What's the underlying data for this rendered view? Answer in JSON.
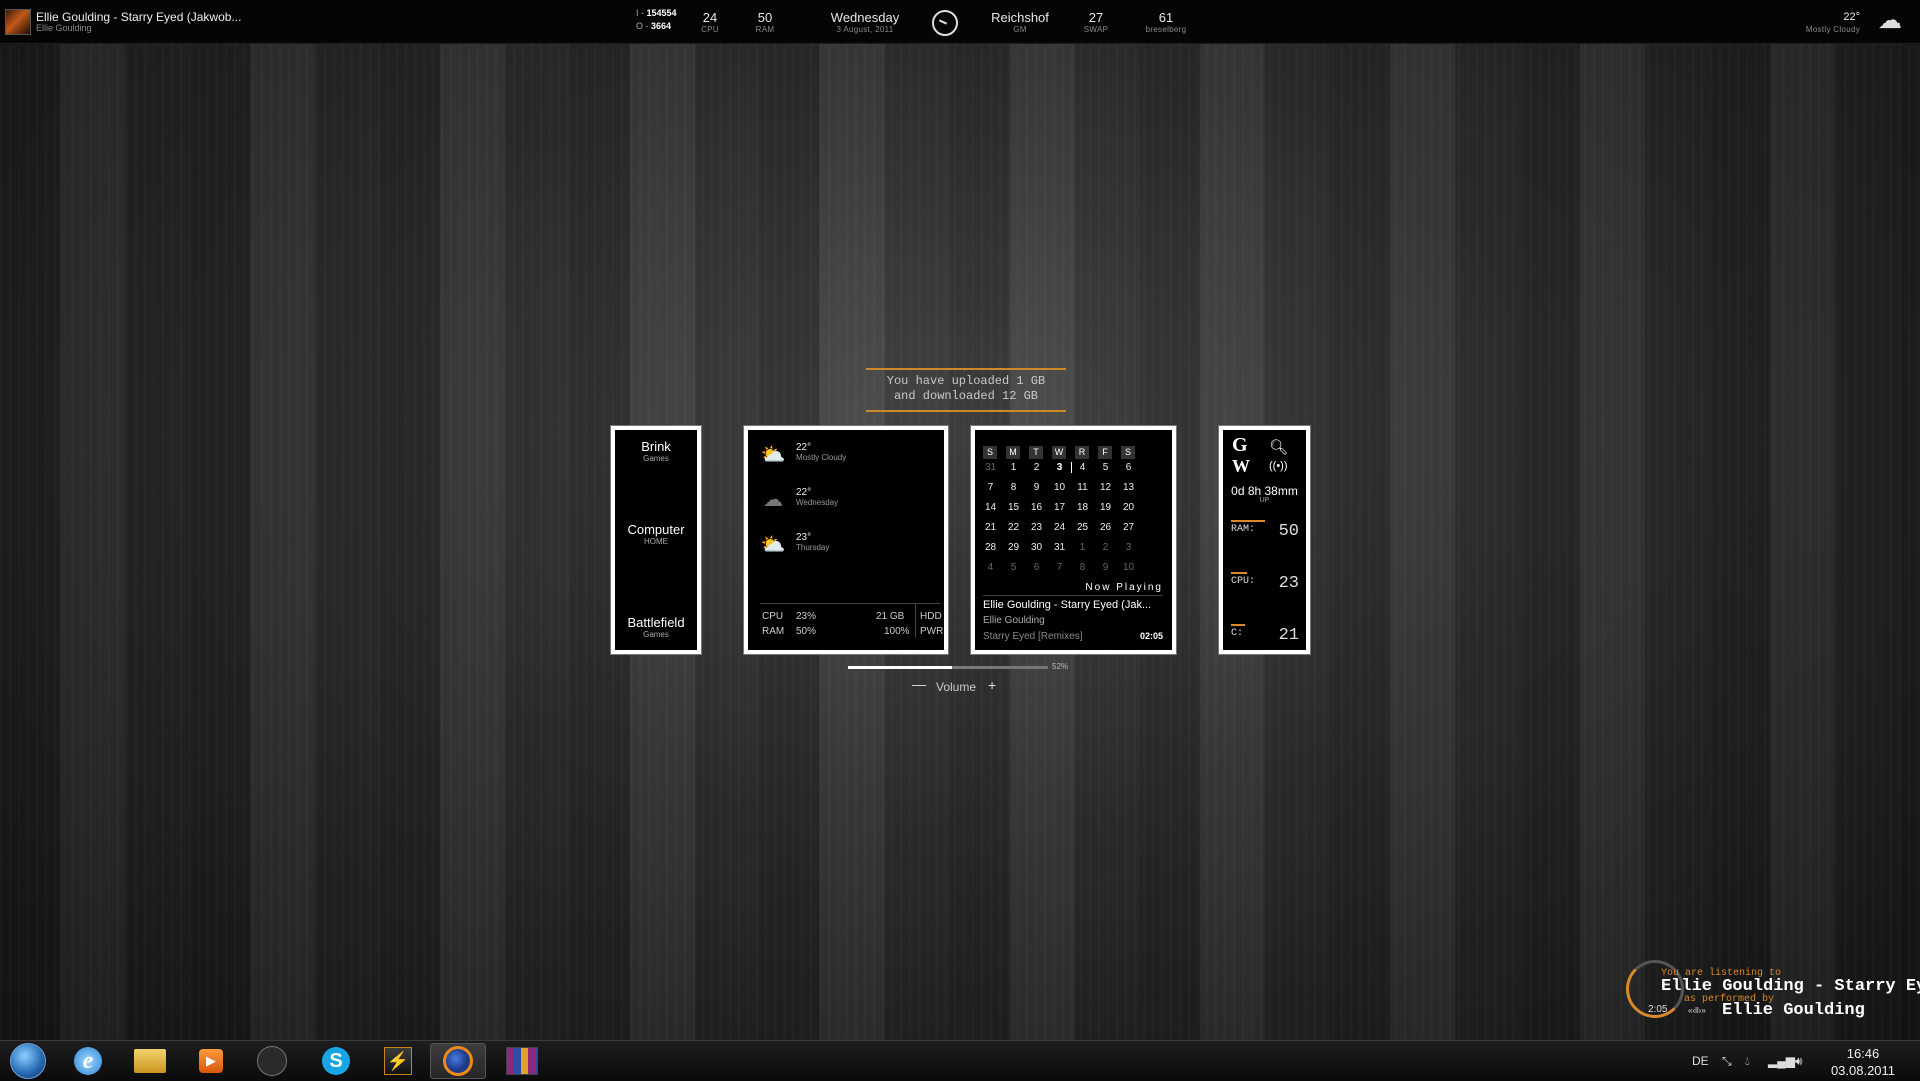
{
  "topbar": {
    "now_playing": {
      "title": "Ellie Goulding - Starry Eyed (Jakwob...",
      "artist": "Ellie Goulding"
    },
    "network": {
      "in_label": "I -",
      "in_value": "154554",
      "out_label": "O -",
      "out_value": "3664"
    },
    "cpu": {
      "value": "24",
      "label": "CPU"
    },
    "ram": {
      "value": "50",
      "label": "RAM"
    },
    "date": {
      "day": "Wednesday",
      "full": "3 August, 2011"
    },
    "user": {
      "name": "Reichshof",
      "sub": "GM"
    },
    "swap": {
      "value": "27",
      "label": "SWAP"
    },
    "location": {
      "value": "61",
      "label": "breselberg"
    },
    "weather": {
      "temp": "22°",
      "desc": "Mostly Cloudy"
    },
    "icons": {
      "clock": "clock-icon",
      "weather": "cloud-icon"
    }
  },
  "upload": {
    "line1": "You have uploaded 1 GB",
    "line2": "and downloaded 12 GB"
  },
  "launcher": [
    {
      "name": "Brink",
      "sub": "Games"
    },
    {
      "name": "Computer",
      "sub": "HOME"
    },
    {
      "name": "Battlefield",
      "sub": "Games"
    }
  ],
  "weather": {
    "days": [
      {
        "temp": "22°",
        "desc": "Mostly Cloudy",
        "icon": "partly-cloudy-icon"
      },
      {
        "temp": "22°",
        "desc": "Wednesday",
        "icon": "rain-cloud-icon"
      },
      {
        "temp": "23°",
        "desc": "Thursday",
        "icon": "sun-cloud-icon"
      }
    ],
    "system": {
      "cpu_label": "CPU",
      "cpu_value": "23%",
      "ram_label": "RAM",
      "ram_value": "50%",
      "hdd_value": "21 GB",
      "hdd_label": "HDD",
      "pwr_value": "100%",
      "pwr_label": "PWR"
    }
  },
  "calendar": {
    "headers": [
      "S",
      "M",
      "T",
      "W",
      "R",
      "F",
      "S"
    ],
    "weeks": [
      [
        "31",
        "1",
        "2",
        "3",
        "4",
        "5",
        "6"
      ],
      [
        "7",
        "8",
        "9",
        "10",
        "11",
        "12",
        "13"
      ],
      [
        "14",
        "15",
        "16",
        "17",
        "18",
        "19",
        "20"
      ],
      [
        "21",
        "22",
        "23",
        "24",
        "25",
        "26",
        "27"
      ],
      [
        "28",
        "29",
        "30",
        "31",
        "1",
        "2",
        "3"
      ],
      [
        "4",
        "5",
        "6",
        "7",
        "8",
        "9",
        "10"
      ]
    ],
    "dim_cells": [
      "0-0",
      "4-4",
      "4-5",
      "4-6",
      "5-0",
      "5-1",
      "5-2",
      "5-3",
      "5-4",
      "5-5",
      "5-6"
    ],
    "today_cell": "0-3"
  },
  "now_playing_panel": {
    "header": "Now Playing",
    "track": "Ellie Goulding - Starry Eyed (Jak...",
    "artist": "Ellie Goulding",
    "album": "Starry Eyed [Remixes]",
    "time": "02:05"
  },
  "sysmon": {
    "uptime": "0d 8h 38mm",
    "uptime_label": "UP",
    "ram_label": "RAM:",
    "ram_value": "50",
    "cpu_label": "CPU:",
    "cpu_value": "23",
    "disk_label": "C:",
    "disk_value": "21",
    "ram_fill": 0.5,
    "cpu_fill": 0.23,
    "disk_fill": 0.21
  },
  "volume": {
    "label": "Volume",
    "percent": "52%",
    "value": 0.52,
    "minus": "—",
    "plus": "+"
  },
  "listening": {
    "line1": "You are listening to",
    "track": "Ellie Goulding - Starry Eyed (Jakwob Remix)",
    "line3": "as performed by",
    "artist": "Ellie Goulding",
    "time": "2:05",
    "controls": "«‹ll›»"
  },
  "taskbar": {
    "apps": [
      "start-orb",
      "internet-explorer",
      "file-explorer",
      "media-player",
      "steam",
      "skype",
      "winamp",
      "firefox",
      "winrar"
    ],
    "tray": {
      "lang": "DE",
      "time": "16:46",
      "date": "03.08.2011"
    }
  }
}
